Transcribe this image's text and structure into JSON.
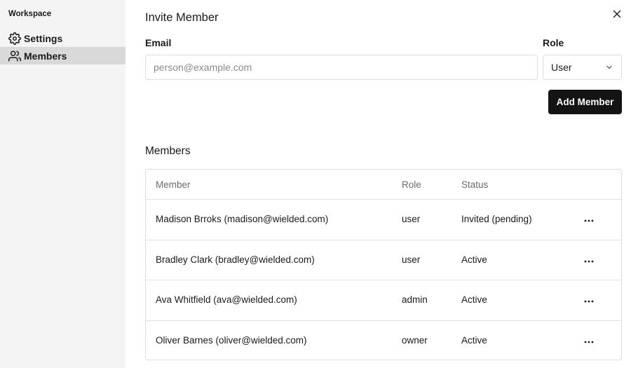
{
  "sidebar": {
    "workspace_label": "Workspace",
    "items": [
      {
        "label": "Settings",
        "icon": "gear-icon",
        "active": false
      },
      {
        "label": "Members",
        "icon": "users-icon",
        "active": true
      }
    ]
  },
  "modal": {
    "title": "Invite Member",
    "email_label": "Email",
    "email_placeholder": "person@example.com",
    "email_value": "",
    "role_label": "Role",
    "role_value": "User",
    "add_button": "Add Member"
  },
  "members": {
    "title": "Members",
    "columns": [
      "Member",
      "Role",
      "Status"
    ],
    "rows": [
      {
        "member": "Madison Brroks (madison@wielded.com)",
        "role": "user",
        "status": "Invited (pending)"
      },
      {
        "member": "Bradley Clark (bradley@wielded.com)",
        "role": "user",
        "status": "Active"
      },
      {
        "member": "Ava Whitfield (ava@wielded.com)",
        "role": "admin",
        "status": "Active"
      },
      {
        "member": "Oliver Barnes (oliver@wielded.com)",
        "role": "owner",
        "status": "Active"
      }
    ]
  },
  "colors": {
    "sidebar_bg": "#f4f4f4",
    "sidebar_active": "#d9d9d9",
    "primary_button": "#141414",
    "border": "#dddddd"
  }
}
